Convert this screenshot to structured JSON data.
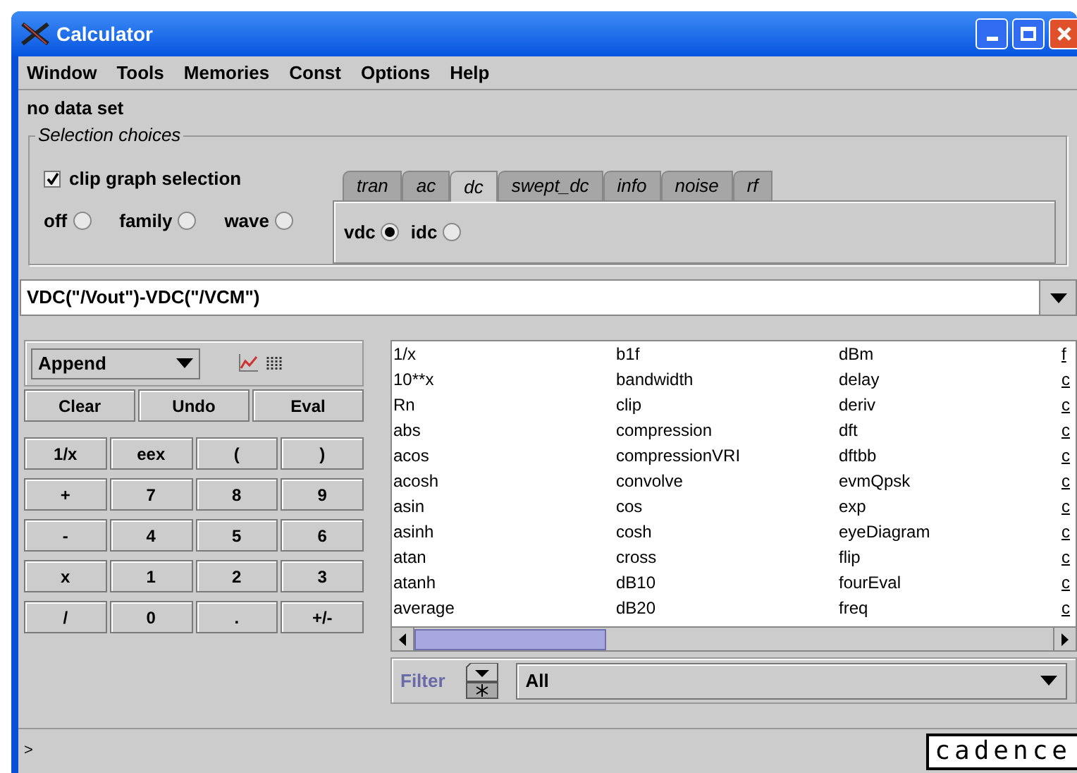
{
  "window": {
    "title": "Calculator"
  },
  "menu": [
    "Window",
    "Tools",
    "Memories",
    "Const",
    "Options",
    "Help"
  ],
  "status_text": "no data set",
  "selection": {
    "title": "Selection choices",
    "clip": {
      "label": "clip graph selection",
      "checked": true
    },
    "modes": [
      {
        "label": "off",
        "selected": false
      },
      {
        "label": "family",
        "selected": false
      },
      {
        "label": "wave",
        "selected": false
      }
    ],
    "tabs": [
      {
        "label": "tran",
        "selected": false
      },
      {
        "label": "ac",
        "selected": false
      },
      {
        "label": "dc",
        "selected": true
      },
      {
        "label": "swept_dc",
        "selected": false
      },
      {
        "label": "info",
        "selected": false
      },
      {
        "label": "noise",
        "selected": false
      },
      {
        "label": "rf",
        "selected": false
      }
    ],
    "tab_options": [
      {
        "label": "vdc",
        "selected": true
      },
      {
        "label": "idc",
        "selected": false
      }
    ]
  },
  "expression": {
    "value": "VDC(\"/Vout\")-VDC(\"/VCM\")"
  },
  "keypad": {
    "mode": "Append",
    "actions": [
      "Clear",
      "Undo",
      "Eval"
    ],
    "keys": [
      "1/x",
      "eex",
      "(",
      ")",
      "+",
      "7",
      "8",
      "9",
      "-",
      "4",
      "5",
      "6",
      "x",
      "1",
      "2",
      "3",
      "/",
      "0",
      ".",
      "+/-"
    ]
  },
  "functions": {
    "columns": [
      [
        "1/x",
        "10**x",
        "Rn",
        "abs",
        "acos",
        "acosh",
        "asin",
        "asinh",
        "atan",
        "atanh",
        "average"
      ],
      [
        "b1f",
        "bandwidth",
        "clip",
        "compression",
        "compressionVRI",
        "convolve",
        "cos",
        "cosh",
        "cross",
        "dB10",
        "dB20"
      ],
      [
        "dBm",
        "delay",
        "deriv",
        "dft",
        "dftbb",
        "evmQpsk",
        "exp",
        "eyeDiagram",
        "flip",
        "fourEval",
        "freq"
      ],
      [
        "f",
        "c",
        "c",
        "c",
        "c",
        "c",
        "c",
        "c",
        "c",
        "c",
        "c"
      ]
    ]
  },
  "filter": {
    "label": "Filter",
    "value": "All"
  },
  "prompt": ">",
  "logo": "cadence"
}
